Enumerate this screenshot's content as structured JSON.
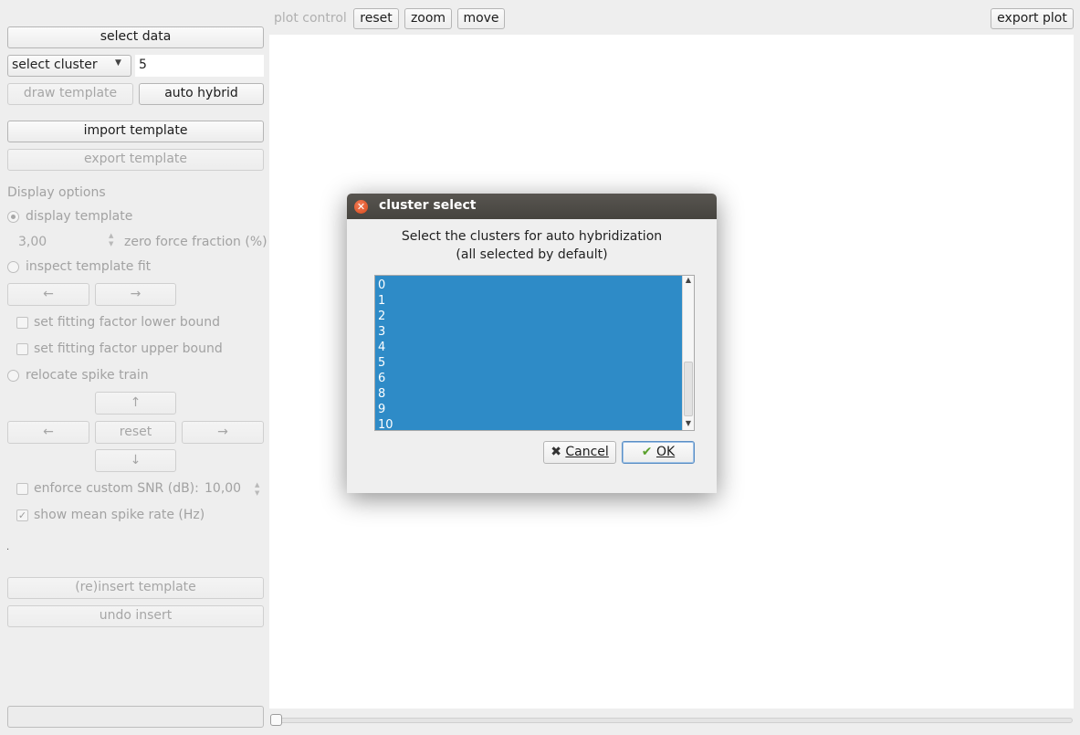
{
  "toolbar": {
    "plot_control_label": "plot control",
    "reset_label": "reset",
    "zoom_label": "zoom",
    "move_label": "move",
    "export_plot_label": "export plot"
  },
  "sidebar": {
    "select_data_label": "select data",
    "select_cluster_label": "select cluster",
    "cluster_value": "5",
    "draw_template_label": "draw template",
    "auto_hybrid_label": "auto hybrid",
    "import_template_label": "import template",
    "export_template_label": "export template",
    "display_options_heading": "Display options",
    "display_template_label": "display template",
    "zero_force_value": "3,00",
    "zero_force_label": "zero force fraction (%)",
    "inspect_fit_label": "inspect template fit",
    "left_arrow": "←",
    "right_arrow": "→",
    "up_arrow": "↑",
    "down_arrow": "↓",
    "lower_bound_label": "set fitting factor lower bound",
    "upper_bound_label": "set fitting factor upper bound",
    "relocate_label": "relocate spike train",
    "reset_label": "reset",
    "snr_label": "enforce custom SNR (dB):",
    "snr_value": "10,00",
    "mean_rate_label": "show mean spike rate (Hz)",
    "dot": ".",
    "reinsert_label": "(re)insert template",
    "undo_label": "undo insert"
  },
  "dialog": {
    "title": "cluster select",
    "message_line1": "Select the clusters for auto hybridization",
    "message_line2": "(all selected by default)",
    "clusters": [
      "0",
      "1",
      "2",
      "3",
      "4",
      "5",
      "6",
      "8",
      "9",
      "10"
    ],
    "cancel_label": "Cancel",
    "ok_label": "OK"
  },
  "colors": {
    "selection": "#2e8bc7",
    "titlebar": "#4e4c47",
    "close": "#e05a2b"
  }
}
